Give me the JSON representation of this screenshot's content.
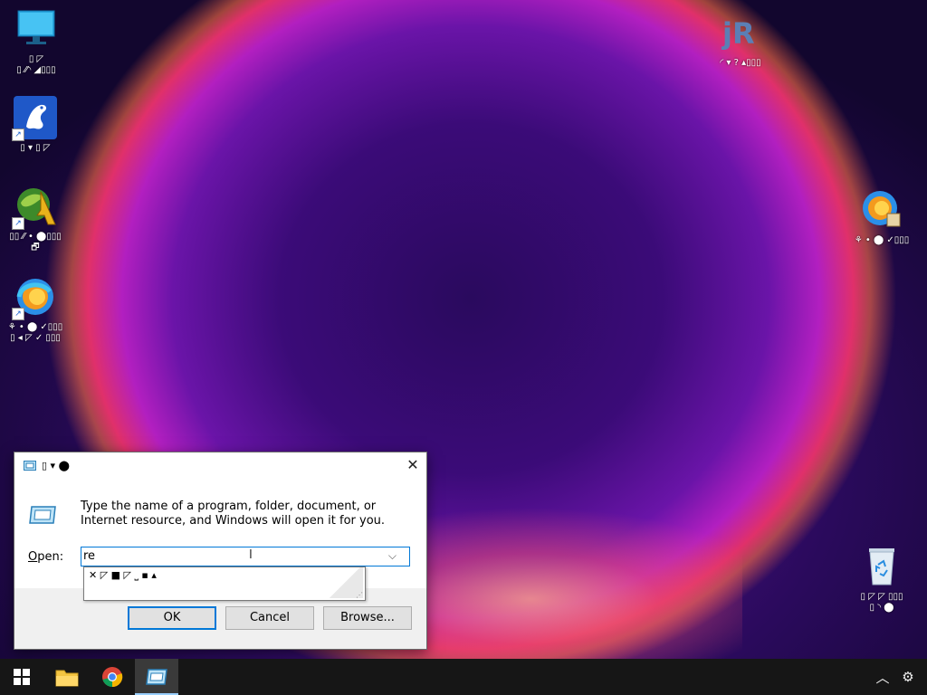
{
  "desktop": {
    "icons_left": [
      {
        "name": "this-pc",
        "label": "▯ ◸\n▯ ⁄⁄◝ ◢▯▯▯"
      },
      {
        "name": "app-frog",
        "label": "▯ ▾ ▯ ◸"
      },
      {
        "name": "app-globe",
        "label": "▯▯ ⁄⁄ • ⬤▯▯▯\n🗗"
      },
      {
        "name": "app-edge",
        "label": "⚘ • ⬤ ✓▯▯▯\n▯ ◂ ◸ ✓ ▯▯▯"
      }
    ],
    "icons_right": [
      {
        "name": "app-jr",
        "label": "◜ ▾ ? ▴▯▯▯"
      },
      {
        "name": "app-edge-2",
        "label": "⚘ • ⬤ ✓▯▯▯"
      },
      {
        "name": "recycle-bin",
        "label": "▯ ◸ ◸ ▯▯▯\n▯ ◝ ⬤"
      }
    ]
  },
  "run_dialog": {
    "title": "▯ ▾ ⬤",
    "description": "Type the name of a program, folder, document, or Internet resource, and Windows will open it for you.",
    "open_label_prefix": "",
    "open_label_underlined": "O",
    "open_label_rest": "pen:",
    "open_value": "re",
    "suggestion": "✕ ◸ ■ ◸ ⎵ ▪ ▴",
    "buttons": {
      "ok": "OK",
      "cancel": "Cancel",
      "browse": "Browse..."
    }
  },
  "taskbar": {
    "items": [
      "start",
      "file-explorer",
      "chrome",
      "run"
    ],
    "tray": [
      "show-hidden",
      "settings"
    ]
  },
  "colors": {
    "accent": "#0078d7",
    "taskbar": "#161616"
  }
}
